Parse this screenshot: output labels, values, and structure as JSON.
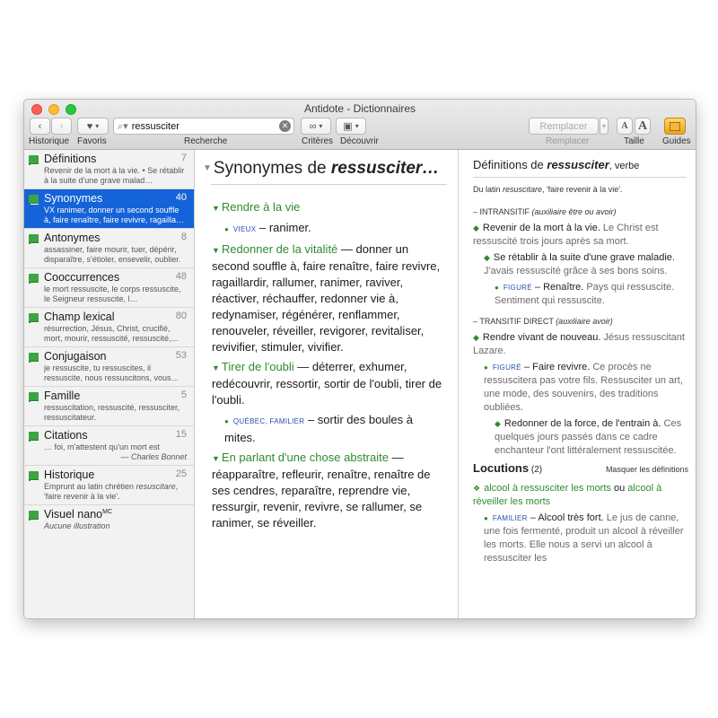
{
  "window": {
    "title": "Antidote - Dictionnaires"
  },
  "toolbar": {
    "back_icon": "chevron-left-icon",
    "forward_icon": "chevron-right-icon",
    "labels": {
      "historique": "Historique",
      "favoris": "Favoris",
      "recherche": "Recherche",
      "criteres": "Critères",
      "decouvrir": "Découvrir",
      "remplacer": "Remplacer",
      "taille": "Taille",
      "guides": "Guides"
    },
    "search_value": "ressusciter",
    "replace_placeholder": "Remplacer",
    "size_small": "A",
    "size_large": "A"
  },
  "sidebar": {
    "items": [
      {
        "label": "Définitions",
        "count": "7",
        "desc": "Revenir de la mort à la vie. • Se rétablir à la suite d'une grave malad…"
      },
      {
        "label": "Synonymes",
        "count": "40",
        "desc": "VX ranimer, donner un second souffle à, faire renaître, faire revivre, ragailla…"
      },
      {
        "label": "Antonymes",
        "count": "8",
        "desc": "assassiner, faire mourir, tuer, dépérir, disparaître, s'étioler, ensevelir, oublier."
      },
      {
        "label": "Cooccurrences",
        "count": "48",
        "desc": "le mort ressuscite, le corps ressuscite, le Seigneur ressuscite, l…"
      },
      {
        "label": "Champ lexical",
        "count": "80",
        "desc": "résurrection, Jésus, Christ, crucifié, mort, mourir, ressuscité, ressuscité,…"
      },
      {
        "label": "Conjugaison",
        "count": "53",
        "desc": "je ressuscite, tu ressuscites, il ressuscite, nous ressuscitons, vous…"
      },
      {
        "label": "Famille",
        "count": "5",
        "desc": "ressuscitation, ressuscité, ressusciter, ressuscitateur."
      },
      {
        "label": "Citations",
        "count": "15",
        "desc": "… foi, m'attestent qu'un mort est ressuscité.",
        "cite": "— Charles Bonnet"
      },
      {
        "label": "Historique",
        "count": "25",
        "desc_a": "Emprunt au latin chrétien ",
        "desc_i": "resuscitare",
        "desc_b": ", 'faire revenir à la vie'."
      },
      {
        "label": "Visuel nano",
        "sup": "MC",
        "desc": "Aucune illustration"
      }
    ]
  },
  "center": {
    "title_a": "Synonymes de ",
    "title_b": "ressusciter…",
    "s1_head": "Rendre à la vie",
    "s1_tag": "VIEUX",
    "s1_text": " – ranimer.",
    "s2_head": "Redonner de la vitalité",
    "s2_text": " — donner un second souffle à, faire renaître, faire revivre, ragaillardir, rallumer, ranimer, raviver, réactiver, réchauffer, redonner vie à, redynamiser, régénérer, renflammer, renouveler, réveiller, revigorer, revitaliser, revivifier, stimuler, vivifier.",
    "s3_head": "Tirer de l'oubli",
    "s3_text": " — déterrer, exhumer, redécouvrir, ressortir, sortir de l'oubli, tirer de l'oubli.",
    "s3_tag": "QUÉBEC, FAMILIER",
    "s3_sub": " – sortir des boules à mites.",
    "s4_head": "En parlant d'une chose abstraite",
    "s4_text": " — réapparaître, refleurir, renaître, renaître de ses cendres, reparaître, reprendre vie, ressurgir, revenir, revivre, se rallumer, se ranimer, se réveiller."
  },
  "right": {
    "title_a": "Définitions de ",
    "title_b": "ressusciter",
    "title_c": ", verbe",
    "etym_a": "Du latin ",
    "etym_i": "resuscitare",
    "etym_b": ", 'faire revenir à la vie'.",
    "intr_label": "– INTRANSITIF ",
    "intr_note": "(auxiliaire être ou avoir)",
    "d1_a": "Revenir de la mort à la vie.",
    "d1_b": " Le Christ est ressuscité trois jours après sa mort.",
    "d2_a": "Se rétablir à la suite d'une grave maladie.",
    "d2_b": " J'avais ressuscité grâce à ses bons soins.",
    "d3_tag": "FIGURÉ",
    "d3_a": " – Renaître.",
    "d3_b": " Pays qui ressuscite. Sentiment qui ressuscite.",
    "tr_label": "– TRANSITIF DIRECT ",
    "tr_note": "(auxiliaire avoir)",
    "d4_a": "Rendre vivant de nouveau.",
    "d4_b": " Jésus ressuscitant Lazare.",
    "d5_tag": "FIGURÉ",
    "d5_a": " – Faire revivre.",
    "d5_b": " Ce procès ne ressuscitera pas votre fils. Ressusciter un art, une mode, des souvenirs, des traditions oubliées.",
    "d6_a": "Redonner de la force, de l'entrain à.",
    "d6_b": " Ces quelques jours passés dans ce cadre enchanteur l'ont littéralement ressuscitée.",
    "loc_title": "Locutions",
    "loc_count": " (2)",
    "loc_link": "Masquer les définitions",
    "l1_a": "alcool à ressusciter les morts",
    "l1_or": " ou ",
    "l1_b": "alcool à réveiller les morts",
    "l2_tag": "FAMILIER",
    "l2_a": " – Alcool très fort.",
    "l2_b": " Le jus de canne, une fois fermenté, produit un alcool à réveiller les morts. Elle nous a servi un alcool à ressusciter les"
  }
}
